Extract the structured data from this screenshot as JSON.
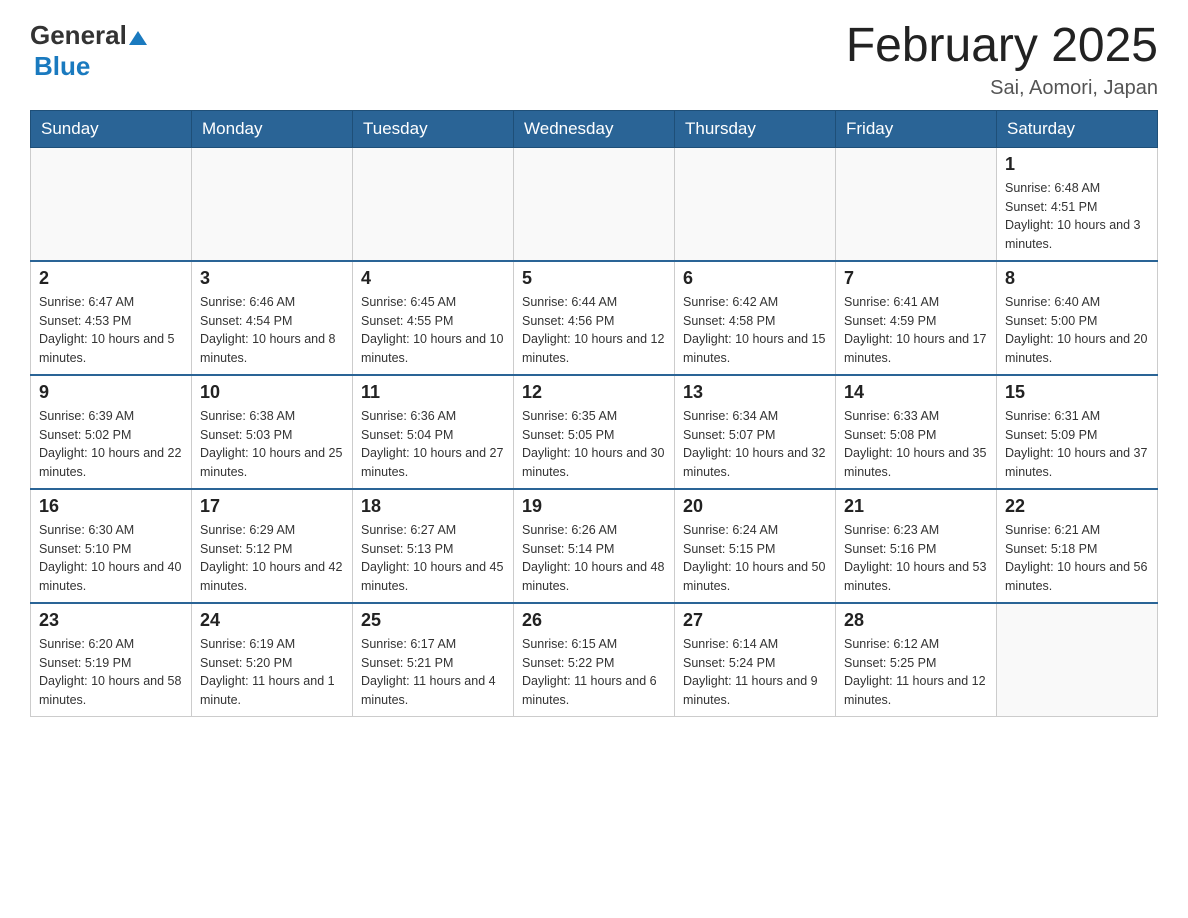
{
  "header": {
    "logo_general": "General",
    "logo_blue": "Blue",
    "title": "February 2025",
    "subtitle": "Sai, Aomori, Japan"
  },
  "weekdays": [
    "Sunday",
    "Monday",
    "Tuesday",
    "Wednesday",
    "Thursday",
    "Friday",
    "Saturday"
  ],
  "weeks": [
    [
      {
        "day": "",
        "info": ""
      },
      {
        "day": "",
        "info": ""
      },
      {
        "day": "",
        "info": ""
      },
      {
        "day": "",
        "info": ""
      },
      {
        "day": "",
        "info": ""
      },
      {
        "day": "",
        "info": ""
      },
      {
        "day": "1",
        "info": "Sunrise: 6:48 AM\nSunset: 4:51 PM\nDaylight: 10 hours and 3 minutes."
      }
    ],
    [
      {
        "day": "2",
        "info": "Sunrise: 6:47 AM\nSunset: 4:53 PM\nDaylight: 10 hours and 5 minutes."
      },
      {
        "day": "3",
        "info": "Sunrise: 6:46 AM\nSunset: 4:54 PM\nDaylight: 10 hours and 8 minutes."
      },
      {
        "day": "4",
        "info": "Sunrise: 6:45 AM\nSunset: 4:55 PM\nDaylight: 10 hours and 10 minutes."
      },
      {
        "day": "5",
        "info": "Sunrise: 6:44 AM\nSunset: 4:56 PM\nDaylight: 10 hours and 12 minutes."
      },
      {
        "day": "6",
        "info": "Sunrise: 6:42 AM\nSunset: 4:58 PM\nDaylight: 10 hours and 15 minutes."
      },
      {
        "day": "7",
        "info": "Sunrise: 6:41 AM\nSunset: 4:59 PM\nDaylight: 10 hours and 17 minutes."
      },
      {
        "day": "8",
        "info": "Sunrise: 6:40 AM\nSunset: 5:00 PM\nDaylight: 10 hours and 20 minutes."
      }
    ],
    [
      {
        "day": "9",
        "info": "Sunrise: 6:39 AM\nSunset: 5:02 PM\nDaylight: 10 hours and 22 minutes."
      },
      {
        "day": "10",
        "info": "Sunrise: 6:38 AM\nSunset: 5:03 PM\nDaylight: 10 hours and 25 minutes."
      },
      {
        "day": "11",
        "info": "Sunrise: 6:36 AM\nSunset: 5:04 PM\nDaylight: 10 hours and 27 minutes."
      },
      {
        "day": "12",
        "info": "Sunrise: 6:35 AM\nSunset: 5:05 PM\nDaylight: 10 hours and 30 minutes."
      },
      {
        "day": "13",
        "info": "Sunrise: 6:34 AM\nSunset: 5:07 PM\nDaylight: 10 hours and 32 minutes."
      },
      {
        "day": "14",
        "info": "Sunrise: 6:33 AM\nSunset: 5:08 PM\nDaylight: 10 hours and 35 minutes."
      },
      {
        "day": "15",
        "info": "Sunrise: 6:31 AM\nSunset: 5:09 PM\nDaylight: 10 hours and 37 minutes."
      }
    ],
    [
      {
        "day": "16",
        "info": "Sunrise: 6:30 AM\nSunset: 5:10 PM\nDaylight: 10 hours and 40 minutes."
      },
      {
        "day": "17",
        "info": "Sunrise: 6:29 AM\nSunset: 5:12 PM\nDaylight: 10 hours and 42 minutes."
      },
      {
        "day": "18",
        "info": "Sunrise: 6:27 AM\nSunset: 5:13 PM\nDaylight: 10 hours and 45 minutes."
      },
      {
        "day": "19",
        "info": "Sunrise: 6:26 AM\nSunset: 5:14 PM\nDaylight: 10 hours and 48 minutes."
      },
      {
        "day": "20",
        "info": "Sunrise: 6:24 AM\nSunset: 5:15 PM\nDaylight: 10 hours and 50 minutes."
      },
      {
        "day": "21",
        "info": "Sunrise: 6:23 AM\nSunset: 5:16 PM\nDaylight: 10 hours and 53 minutes."
      },
      {
        "day": "22",
        "info": "Sunrise: 6:21 AM\nSunset: 5:18 PM\nDaylight: 10 hours and 56 minutes."
      }
    ],
    [
      {
        "day": "23",
        "info": "Sunrise: 6:20 AM\nSunset: 5:19 PM\nDaylight: 10 hours and 58 minutes."
      },
      {
        "day": "24",
        "info": "Sunrise: 6:19 AM\nSunset: 5:20 PM\nDaylight: 11 hours and 1 minute."
      },
      {
        "day": "25",
        "info": "Sunrise: 6:17 AM\nSunset: 5:21 PM\nDaylight: 11 hours and 4 minutes."
      },
      {
        "day": "26",
        "info": "Sunrise: 6:15 AM\nSunset: 5:22 PM\nDaylight: 11 hours and 6 minutes."
      },
      {
        "day": "27",
        "info": "Sunrise: 6:14 AM\nSunset: 5:24 PM\nDaylight: 11 hours and 9 minutes."
      },
      {
        "day": "28",
        "info": "Sunrise: 6:12 AM\nSunset: 5:25 PM\nDaylight: 11 hours and 12 minutes."
      },
      {
        "day": "",
        "info": ""
      }
    ]
  ]
}
